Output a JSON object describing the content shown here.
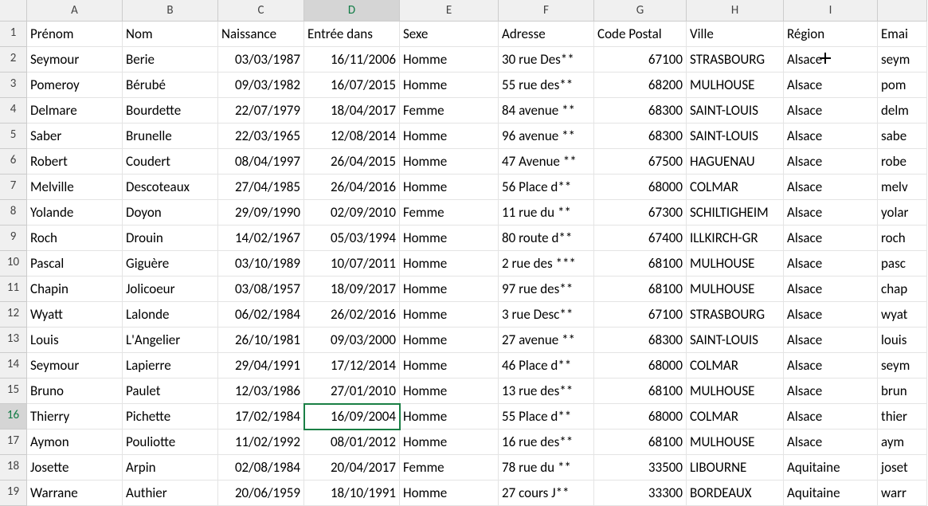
{
  "columns": [
    "A",
    "B",
    "C",
    "D",
    "E",
    "F",
    "G",
    "H",
    "I",
    ""
  ],
  "header_row": [
    "Prénom",
    "Nom",
    "Naissance",
    "Entrée dans",
    "Sexe",
    "Adresse",
    "Code Postal",
    "Ville",
    "Région",
    "Emai"
  ],
  "rows": [
    {
      "n": 2,
      "a": "Seymour",
      "b": "Berie",
      "c": "03/03/1987",
      "d": "16/11/2006",
      "e": "Homme",
      "f": "30 rue Des**",
      "g": "67100",
      "h": "STRASBOURG",
      "i": "Alsace",
      "j": "seym"
    },
    {
      "n": 3,
      "a": "Pomeroy",
      "b": "Bérubé",
      "c": "09/03/1982",
      "d": "16/07/2015",
      "e": "Homme",
      "f": "55 rue des**",
      "g": "68200",
      "h": "MULHOUSE",
      "i": "Alsace",
      "j": "pom"
    },
    {
      "n": 4,
      "a": "Delmare",
      "b": "Bourdette",
      "c": "22/07/1979",
      "d": "18/04/2017",
      "e": "Femme",
      "f": "84 avenue **",
      "g": "68300",
      "h": "SAINT-LOUIS",
      "i": "Alsace",
      "j": "delm"
    },
    {
      "n": 5,
      "a": "Saber",
      "b": "Brunelle",
      "c": "22/03/1965",
      "d": "12/08/2014",
      "e": "Homme",
      "f": "96 avenue **",
      "g": "68300",
      "h": "SAINT-LOUIS",
      "i": "Alsace",
      "j": "sabe"
    },
    {
      "n": 6,
      "a": "Robert",
      "b": "Coudert",
      "c": "08/04/1997",
      "d": "26/04/2015",
      "e": "Homme",
      "f": "47 Avenue **",
      "g": "67500",
      "h": "HAGUENAU",
      "i": "Alsace",
      "j": "robe"
    },
    {
      "n": 7,
      "a": "Melville",
      "b": "Descoteaux",
      "c": "27/04/1985",
      "d": "26/04/2016",
      "e": "Homme",
      "f": "56 Place d**",
      "g": "68000",
      "h": "COLMAR",
      "i": "Alsace",
      "j": "melv"
    },
    {
      "n": 8,
      "a": "Yolande",
      "b": "Doyon",
      "c": "29/09/1990",
      "d": "02/09/2010",
      "e": "Femme",
      "f": "11 rue du **",
      "g": "67300",
      "h": "SCHILTIGHEIM",
      "i": "Alsace",
      "j": "yolar"
    },
    {
      "n": 9,
      "a": "Roch",
      "b": "Drouin",
      "c": "14/02/1967",
      "d": "05/03/1994",
      "e": "Homme",
      "f": "80 route d**",
      "g": "67400",
      "h": "ILLKIRCH-GR",
      "i": "Alsace",
      "j": "roch"
    },
    {
      "n": 10,
      "a": "Pascal",
      "b": "Giguère",
      "c": "03/10/1989",
      "d": "10/07/2011",
      "e": "Homme",
      "f": "2 rue des ***",
      "g": "68100",
      "h": "MULHOUSE",
      "i": "Alsace",
      "j": "pasc"
    },
    {
      "n": 11,
      "a": "Chapin",
      "b": "Jolicoeur",
      "c": "03/08/1957",
      "d": "18/09/2017",
      "e": "Homme",
      "f": "97 rue des**",
      "g": "68100",
      "h": "MULHOUSE",
      "i": "Alsace",
      "j": "chap"
    },
    {
      "n": 12,
      "a": "Wyatt",
      "b": "Lalonde",
      "c": "06/02/1984",
      "d": "26/02/2016",
      "e": "Homme",
      "f": "3 rue Desc**",
      "g": "67100",
      "h": "STRASBOURG",
      "i": "Alsace",
      "j": "wyat"
    },
    {
      "n": 13,
      "a": "Louis",
      "b": "L'Angelier",
      "c": "26/10/1981",
      "d": "09/03/2000",
      "e": "Homme",
      "f": "27 avenue **",
      "g": "68300",
      "h": "SAINT-LOUIS",
      "i": "Alsace",
      "j": "louis"
    },
    {
      "n": 14,
      "a": "Seymour",
      "b": "Lapierre",
      "c": "29/04/1991",
      "d": "17/12/2014",
      "e": "Homme",
      "f": "46 Place d**",
      "g": "68000",
      "h": "COLMAR",
      "i": "Alsace",
      "j": "seym"
    },
    {
      "n": 15,
      "a": "Bruno",
      "b": "Paulet",
      "c": "12/03/1986",
      "d": "27/01/2010",
      "e": "Homme",
      "f": "13 rue des**",
      "g": "68100",
      "h": "MULHOUSE",
      "i": "Alsace",
      "j": "brun"
    },
    {
      "n": 16,
      "a": "Thierry",
      "b": "Pichette",
      "c": "17/02/1984",
      "d": "16/09/2004",
      "e": "Homme",
      "f": "55 Place d**",
      "g": "68000",
      "h": "COLMAR",
      "i": "Alsace",
      "j": "thier"
    },
    {
      "n": 17,
      "a": "Aymon",
      "b": "Pouliotte",
      "c": "11/02/1992",
      "d": "08/01/2012",
      "e": "Homme",
      "f": "16 rue des**",
      "g": "68100",
      "h": "MULHOUSE",
      "i": "Alsace",
      "j": "aym"
    },
    {
      "n": 18,
      "a": "Josette",
      "b": "Arpin",
      "c": "02/08/1984",
      "d": "20/04/2017",
      "e": "Femme",
      "f": "78 rue du **",
      "g": "33500",
      "h": "LIBOURNE",
      "i": "Aquitaine",
      "j": "joset"
    },
    {
      "n": 19,
      "a": "Warrane",
      "b": "Authier",
      "c": "20/06/1959",
      "d": "18/10/1991",
      "e": "Homme",
      "f": "27 cours J**",
      "g": "33300",
      "h": "BORDEAUX",
      "i": "Aquitaine",
      "j": "warr"
    }
  ],
  "selected": {
    "row": 16,
    "col": "D"
  },
  "cursor_row": 6,
  "plus_cursor_row": 2
}
